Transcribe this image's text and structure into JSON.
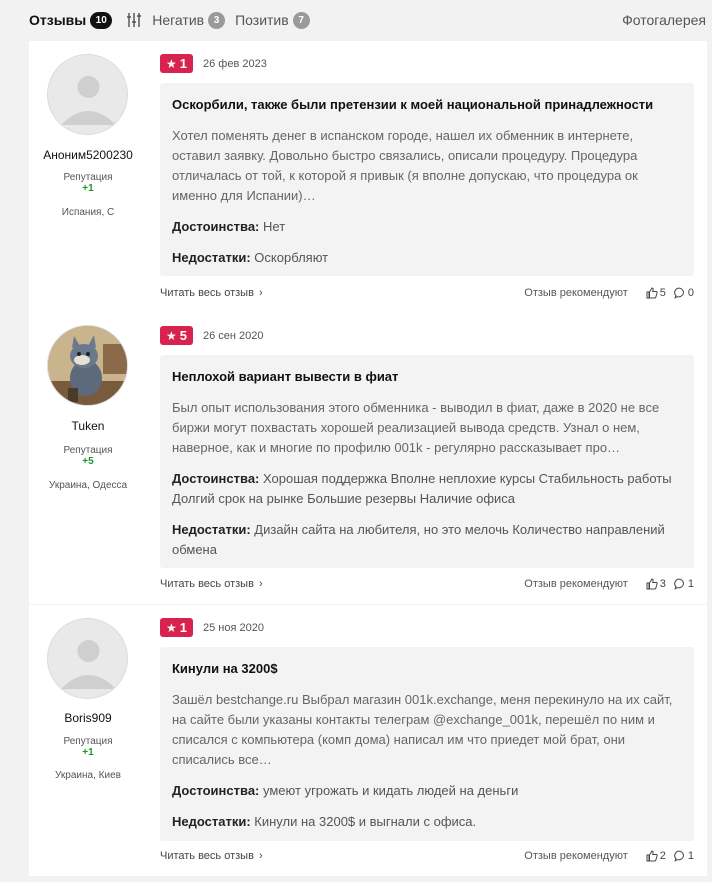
{
  "tabs": {
    "reviews": {
      "label": "Отзывы",
      "count": "10"
    },
    "negative": {
      "label": "Негатив",
      "count": "3"
    },
    "positive": {
      "label": "Позитив",
      "count": "7"
    },
    "gallery": "Фотогалерея"
  },
  "labels": {
    "reputation": "Репутация",
    "pros": "Достоинства:",
    "cons": "Недостатки:",
    "read_more": "Читать весь отзыв",
    "recommend": "Отзыв рекомендуют"
  },
  "reviews": [
    {
      "user": "Аноним5200230",
      "reputation": "+1",
      "location": "Испания, С",
      "rating": "1",
      "date": "26 фев 2023",
      "title": "Оскорбили, также были претензии к моей национальной принадлежности",
      "text": "Хотел поменять денег в испанском городе, нашел их обменник в интернете, оставил заявку. Довольно быстро связались, описали процедуру. Процедура отличалась от той, к которой я привык (я вполне допускаю, что процедура ок именно для Испании)…",
      "pros": "Нет",
      "cons": "Оскорбляют",
      "likes": "5",
      "comments": "0"
    },
    {
      "user": "Tuken",
      "reputation": "+5",
      "location": "Украина, Одесса",
      "rating": "5",
      "date": "26 сен 2020",
      "title": "Неплохой вариант вывести в фиат",
      "text": "Был опыт использования этого обменника - выводил в фиат, даже в 2020 не все биржи могут похвастать хорошей реализацией вывода средств. Узнал о нем, наверное, как и многие по профилю 001k - регулярно рассказывает про…",
      "pros": "Хорошая поддержка Вполне неплохие курсы Стабильность работы Долгий срок на рынке Большие резервы Наличие офиса",
      "cons": "Дизайн сайта на любителя, но это мелочь Количество направлений обмена",
      "likes": "3",
      "comments": "1"
    },
    {
      "user": "Boris909",
      "reputation": "+1",
      "location": "Украина, Киев",
      "rating": "1",
      "date": "25 ноя 2020",
      "title": "Кинули на 3200$",
      "text": "Зашёл bestchange.ru Выбрал магазин 001k.exchange, меня перекинуло на их сайт, на сайте были указаны контакты телеграм @exchange_001k, перешёл по ним и списался с компьютера (комп дома) написал им что приедет мой брат, они списались все…",
      "pros": "умеют угрожать и кидать людей на деньги",
      "cons": "Кинули на 3200$ и выгнали с офиса.",
      "likes": "2",
      "comments": "1"
    }
  ],
  "colors": {
    "rating_badge": "#d9234f",
    "reputation": "#1a9a2a"
  }
}
